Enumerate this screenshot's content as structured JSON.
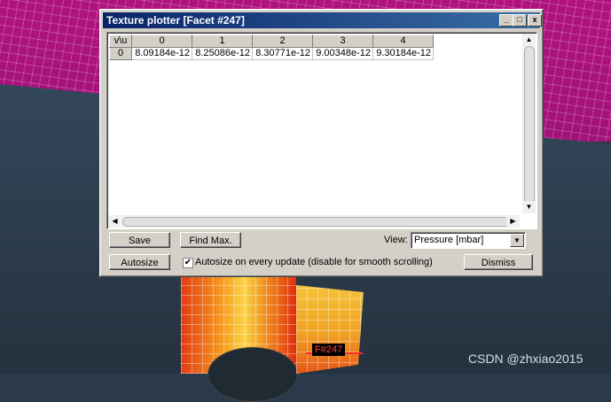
{
  "window": {
    "title": "Texture plotter [Facet #247]",
    "controls": {
      "minimize": "_",
      "maximize": "□",
      "close": "x"
    }
  },
  "grid": {
    "corner": "v\\u",
    "columns": [
      "0",
      "1",
      "2",
      "3",
      "4"
    ],
    "rows": [
      {
        "label": "0",
        "cells": [
          "8.09184e-12",
          "8.25086e-12",
          "8.30771e-12",
          "9.00348e-12",
          "9.30184e-12"
        ]
      }
    ]
  },
  "buttons": {
    "save": "Save",
    "find_max": "Find Max.",
    "autosize": "Autosize",
    "dismiss": "Dismiss"
  },
  "view": {
    "label": "View:",
    "selected": "Pressure [mbar]"
  },
  "autosize_option": {
    "checked": true,
    "label": "Autosize on every update (disable for smooth scrolling)"
  },
  "scene": {
    "facet_label": "F#247"
  },
  "watermark": "CSDN @zhxiao2015"
}
